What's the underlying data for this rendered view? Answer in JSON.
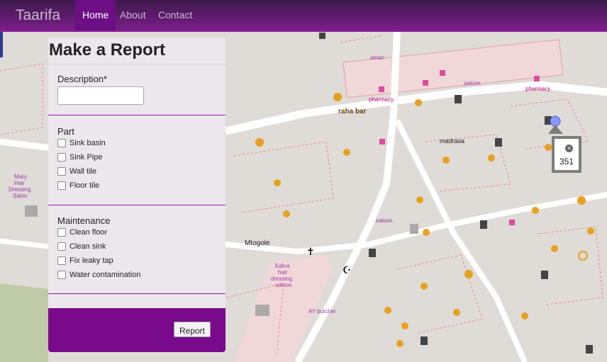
{
  "navbar": {
    "brand": "Taarifa",
    "links": [
      "Home",
      "About",
      "Contact"
    ],
    "active": "Home"
  },
  "report_form": {
    "title": "Make a Report",
    "description_label": "Description*",
    "description_value": "",
    "part_label": "Part",
    "part_options": [
      "Sink basin",
      "Sink Pipe",
      "Wall tile",
      "Floor tile"
    ],
    "maintenance_label": "Maintenance",
    "maintenance_options": [
      "Clean floor",
      "Clean sink",
      "Fix leaky tap",
      "Water contamination"
    ],
    "submit_label": "Report"
  },
  "map": {
    "labels": [
      "raha bar",
      "pharmacy",
      "pharmacy",
      "saloon",
      "madrasa",
      "aman",
      "saloon",
      "Mtogole",
      "Edina hair dressing saloon",
      "AY butcher",
      "Mary Hair Dressing Salon"
    ],
    "popup_count": "351"
  },
  "colors": {
    "navbar": "#6a1a7e",
    "accent": "#7a0a8c",
    "map_background": "#dfdbd6"
  }
}
